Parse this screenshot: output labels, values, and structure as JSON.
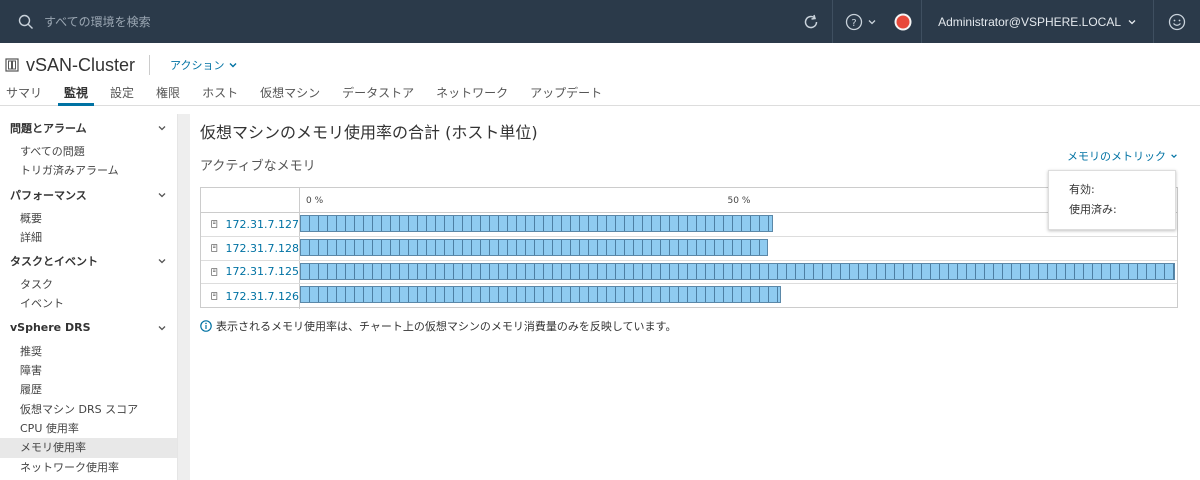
{
  "topbar": {
    "search_placeholder": "すべての環境を検索",
    "user": "Administrator@VSPHERE.LOCAL"
  },
  "object": {
    "title": "vSAN-Cluster",
    "actions_label": "アクション"
  },
  "tabs": [
    "サマリ",
    "監視",
    "設定",
    "権限",
    "ホスト",
    "仮想マシン",
    "データストア",
    "ネットワーク",
    "アップデート"
  ],
  "active_tab": "監視",
  "sidebar": {
    "sections": [
      {
        "label": "問題とアラーム",
        "items": [
          "すべての問題",
          "トリガ済みアラーム"
        ]
      },
      {
        "label": "パフォーマンス",
        "items": [
          "概要",
          "詳細"
        ]
      },
      {
        "label": "タスクとイベント",
        "items": [
          "タスク",
          "イベント"
        ]
      },
      {
        "label": "vSphere DRS",
        "items": [
          "推奨",
          "障害",
          "履歴",
          "仮想マシン DRS スコア",
          "CPU 使用率",
          "メモリ使用率",
          "ネットワーク使用率"
        ]
      }
    ],
    "selected_item": "メモリ使用率"
  },
  "main": {
    "title": "仮想マシンのメモリ使用率の合計 (ホスト単位)",
    "subtitle": "アクティブなメモリ",
    "metric_label": "メモリのメトリック",
    "popover": {
      "line1": "有効:",
      "line2": "使用済み:"
    },
    "note": "表示されるメモリ使用率は、チャート上の仮想マシンのメモリ消費量のみを反映しています。"
  },
  "chart_data": {
    "type": "bar",
    "categories": [
      "172.31.7.127",
      "172.31.7.128",
      "172.31.7.125",
      "172.31.7.126"
    ],
    "values": [
      54,
      53.5,
      100,
      55
    ],
    "unit": "%",
    "tick_labels": [
      "0 %",
      "50 %"
    ],
    "ylim": [
      0,
      100
    ]
  }
}
